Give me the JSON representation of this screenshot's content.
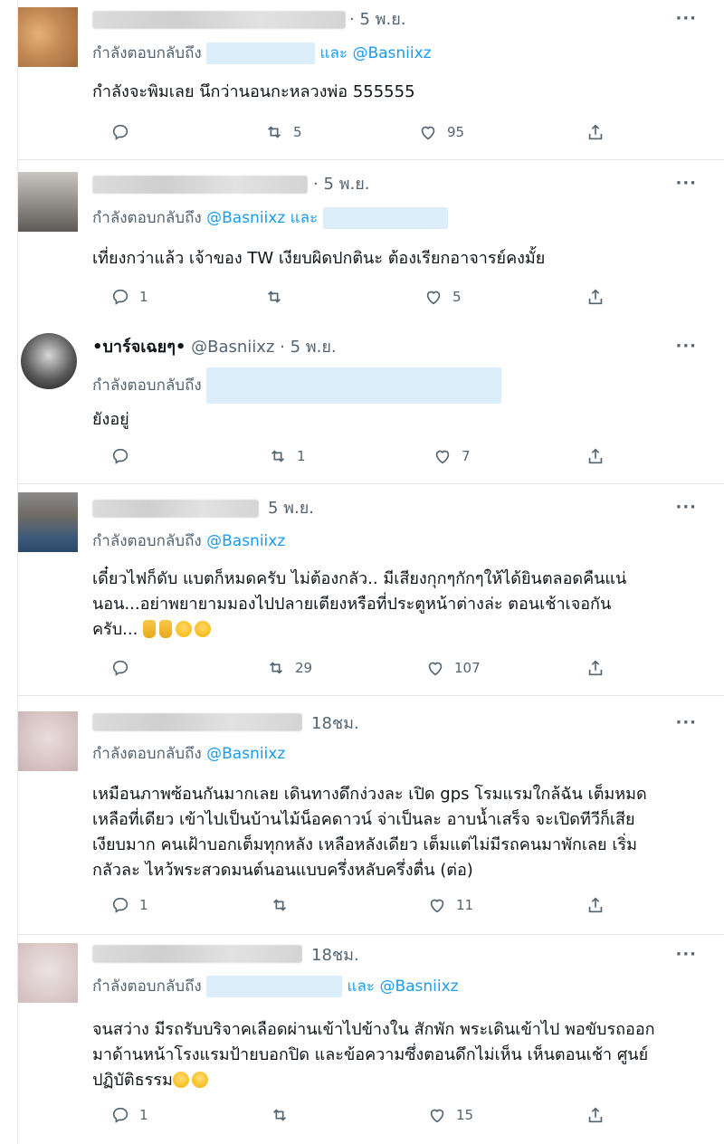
{
  "replying_prefix": "กำลังตอบกลับถึง",
  "and_word": "และ",
  "tweets": [
    {
      "time": "· 5 พ.ย.",
      "reply_handle": "@Basniixz",
      "text": "กำลังจะพิมเลย นึกว่านอนกะหลวงพ่อ 555555",
      "reply_count": "",
      "retweet_count": "5",
      "like_count": "95"
    },
    {
      "time": "· 5 พ.ย.",
      "reply_handle": "@Basniixz",
      "text": "เที่ยงกว่าแล้ว เจ้าของ TW เงียบผิดปกตินะ ต้องเรียกอาจารย์คงมั้ย",
      "reply_count": "1",
      "retweet_count": "",
      "like_count": "5"
    },
    {
      "display_name": "•บาร์จเฉยๆ•",
      "handle": "@Basniixz",
      "time": "· 5 พ.ย.",
      "text": "ยังอยู่",
      "reply_count": "",
      "retweet_count": "1",
      "like_count": "7"
    },
    {
      "time": "5 พ.ย.",
      "reply_handle": "@Basniixz",
      "text_line1": "เดี๋ยวไฟก็ดับ แบตก็หมดครับ ไม่ต้องกลัว.. มีเสียงกุกๆกักๆให้ได้ยินตลอดคืนแน่",
      "text_line2": "นอน...อย่าพยายามมองไปปลายเตียงหรือที่ประตูหน้าต่างล่ะ  ตอนเช้าเจอกัน",
      "text_line3": "ครับ...",
      "reply_count": "",
      "retweet_count": "29",
      "like_count": "107"
    },
    {
      "time": "18ชม.",
      "reply_handle": "@Basniixz",
      "text_line1": "เหมือนภาพซ้อนกันมากเลย เดินทางดึกง่วงละ เปิด gps โรมแรมใกล้ฉัน เต็มหมด",
      "text_line2": "เหลือที่เดียว เข้าไปเป็นบ้านไม้น็อคดาวน์ จ่าเป็นละ อาบน้ำเสร็จ จะเปิดทีวีก็เสีย",
      "text_line3": "เงียบมาก คนเฝ้าบอกเต็มทุกหลัง เหลือหลังเดียว เต็มแต่ไม่มีรถคนมาพักเลย เริ่ม",
      "text_line4": "กลัวละ ไหว้พระสวดมนต์นอนแบบครึ่งหลับครึ่งตื่น (ต่อ)",
      "reply_count": "1",
      "retweet_count": "",
      "like_count": "11"
    },
    {
      "time": "18ชม.",
      "reply_handle": "@Basniixz",
      "text_line1": "จนสว่าง มีรถรับบริจาคเลือดผ่านเข้าไปข้างใน สักพัก พระเดินเข้าไป พอขับรถออก",
      "text_line2": "มาด้านหน้าโรงแรมป้ายบอกปิด และข้อความซึ่งตอนดึกไม่เห็น เห็นตอนเช้า ศูนย์",
      "text_line3": "ปฏิบัติธรรม",
      "reply_count": "1",
      "retweet_count": "",
      "like_count": "15"
    }
  ],
  "more_label": "···",
  "icons": [
    "reply-icon",
    "retweet-icon",
    "like-icon",
    "share-icon",
    "more-icon"
  ],
  "colors": {
    "link": "#1d9bf0",
    "muted": "#536471",
    "text": "#0f1419"
  }
}
